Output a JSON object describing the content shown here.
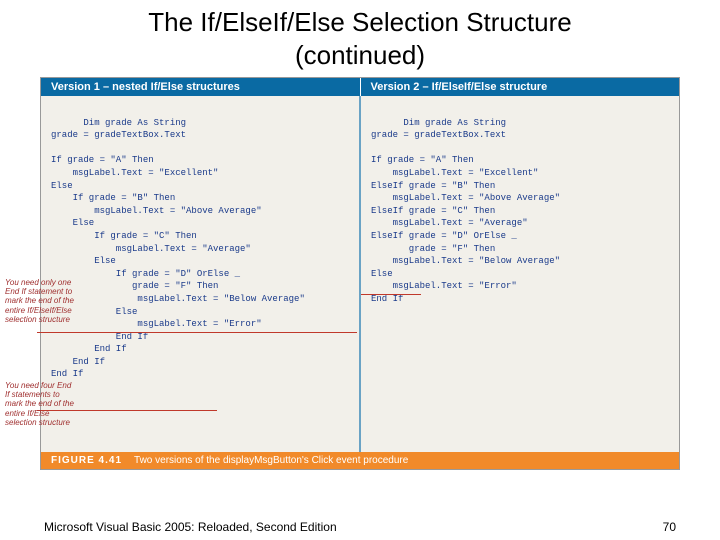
{
  "title": "The If/ElseIf/Else Selection Structure\n(continued)",
  "headers": {
    "left": "Version 1 – nested If/Else structures",
    "right": "Version 2 – If/ElseIf/Else structure"
  },
  "code": {
    "left": "Dim grade As String\ngrade = gradeTextBox.Text\n\nIf grade = \"A\" Then\n    msgLabel.Text = \"Excellent\"\nElse\n    If grade = \"B\" Then\n        msgLabel.Text = \"Above Average\"\n    Else\n        If grade = \"C\" Then\n            msgLabel.Text = \"Average\"\n        Else\n            If grade = \"D\" OrElse _\n               grade = \"F\" Then\n                msgLabel.Text = \"Below Average\"\n            Else\n                msgLabel.Text = \"Error\"\n            End If\n        End If\n    End If\nEnd If",
    "right": "Dim grade As String\ngrade = gradeTextBox.Text\n\nIf grade = \"A\" Then\n    msgLabel.Text = \"Excellent\"\nElseIf grade = \"B\" Then\n    msgLabel.Text = \"Above Average\"\nElseIf grade = \"C\" Then\n    msgLabel.Text = \"Average\"\nElseIf grade = \"D\" OrElse _\n       grade = \"F\" Then\n    msgLabel.Text = \"Below Average\"\nElse\n    msgLabel.Text = \"Error\"\nEnd If"
  },
  "annotations": {
    "a1": "You need only one End If statement to mark the end of the entire If/ElseIf/Else selection structure",
    "a2": "You need four End If statements to mark the end of the entire If/Else selection structure"
  },
  "figure": {
    "label": "FIGURE 4.41",
    "caption": "Two versions of the displayMsgButton's Click event procedure"
  },
  "footer": {
    "left": "Microsoft Visual Basic 2005: Reloaded, Second Edition",
    "right": "70"
  }
}
